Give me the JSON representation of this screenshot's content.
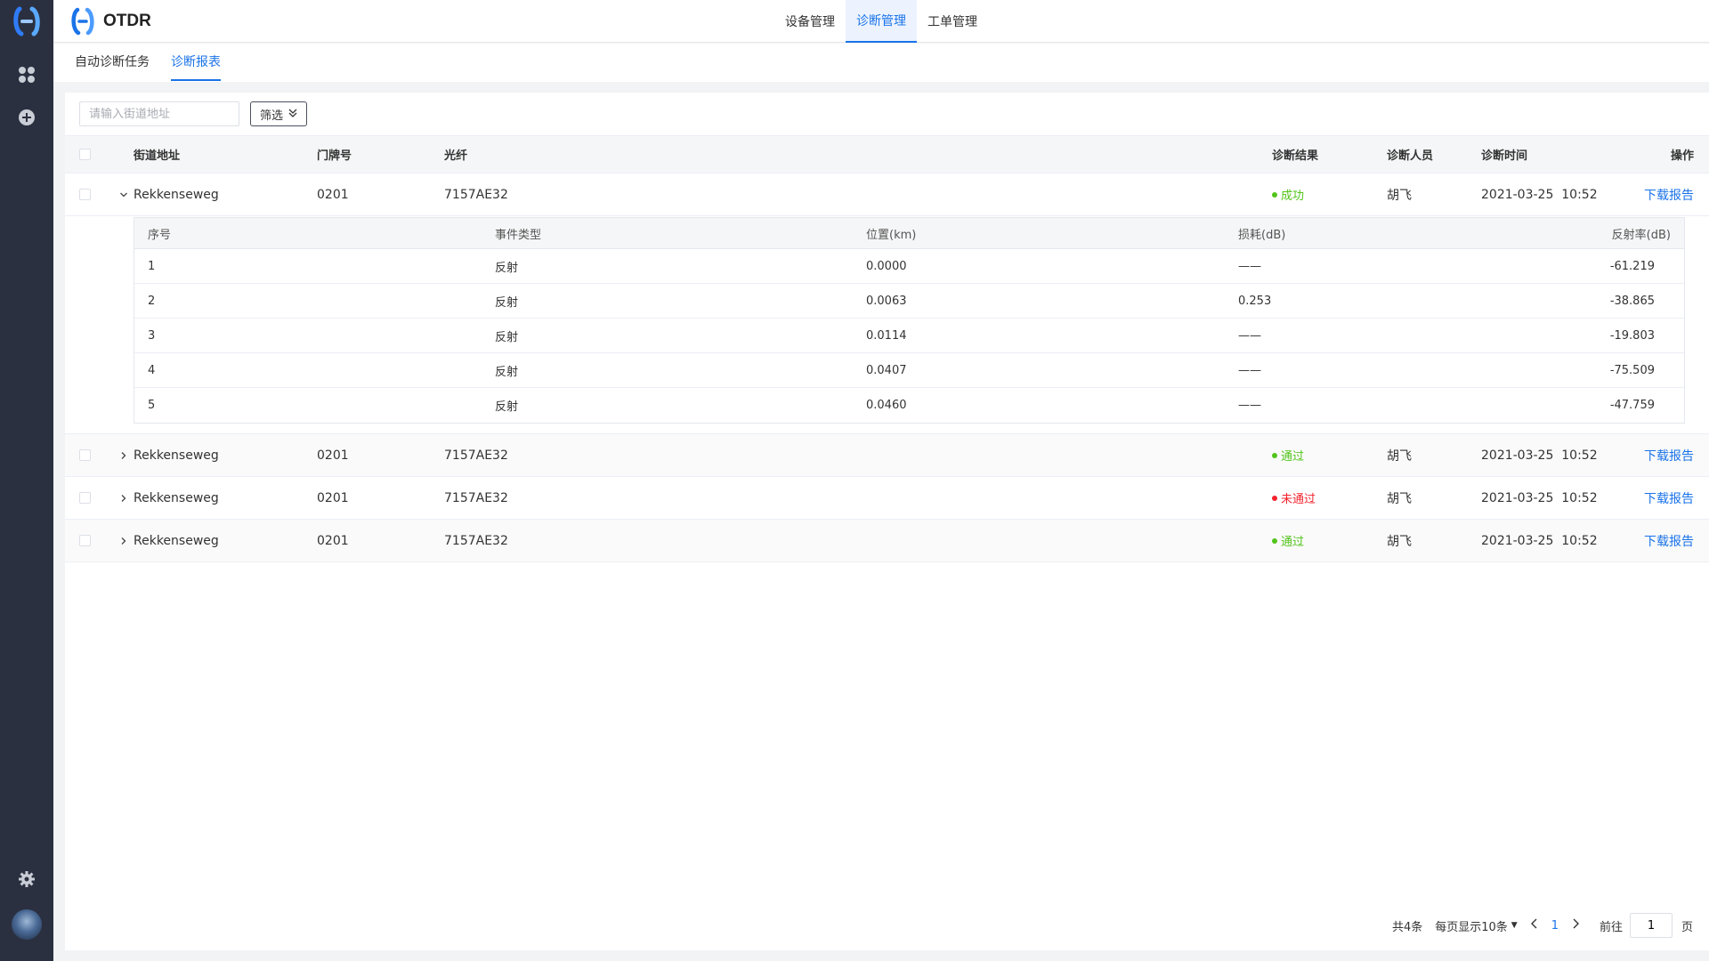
{
  "app": {
    "title": "OTDR",
    "brand_color": "#1a73e8",
    "rail_color": "#2b3040"
  },
  "rail": {
    "items": [
      {
        "icon": "apps-grid-icon"
      },
      {
        "icon": "add-circle-icon"
      },
      {
        "icon": "gear-icon"
      },
      {
        "icon": "avatar"
      }
    ]
  },
  "header": {
    "tabs": [
      {
        "label": "设备管理",
        "active": false
      },
      {
        "label": "诊断管理",
        "active": true
      },
      {
        "label": "工单管理",
        "active": false
      }
    ]
  },
  "subtabs": [
    {
      "label": "自动诊断任务",
      "active": false
    },
    {
      "label": "诊断报表",
      "active": true
    }
  ],
  "toolbar": {
    "search_placeholder": "请输入街道地址",
    "filter_label": "筛选"
  },
  "table": {
    "columns": {
      "street": "街道地址",
      "door": "门牌号",
      "fiber": "光纤",
      "result": "诊断结果",
      "person": "诊断人员",
      "time": "诊断时间",
      "action": "操作"
    },
    "rows": [
      {
        "street": "Rekkenseweg",
        "door": "0201",
        "fiber": "7157AE32",
        "result": "成功",
        "result_color": "#52c41a",
        "person": "胡飞",
        "time": "2021-03-25  10:52",
        "action": "下载报告",
        "expanded": true
      },
      {
        "street": "Rekkenseweg",
        "door": "0201",
        "fiber": "7157AE32",
        "result": "通过",
        "result_color": "#52c41a",
        "person": "胡飞",
        "time": "2021-03-25  10:52",
        "action": "下载报告",
        "expanded": false
      },
      {
        "street": "Rekkenseweg",
        "door": "0201",
        "fiber": "7157AE32",
        "result": "未通过",
        "result_color": "#f5222d",
        "person": "胡飞",
        "time": "2021-03-25  10:52",
        "action": "下载报告",
        "expanded": false
      },
      {
        "street": "Rekkenseweg",
        "door": "0201",
        "fiber": "7157AE32",
        "result": "通过",
        "result_color": "#52c41a",
        "person": "胡飞",
        "time": "2021-03-25  10:52",
        "action": "下载报告",
        "expanded": false
      }
    ],
    "detail": {
      "columns": {
        "index": "序号",
        "event": "事件类型",
        "position": "位置(km)",
        "loss": "损耗(dB)",
        "reflect": "反射率(dB)"
      },
      "rows": [
        {
          "index": "1",
          "event": "反射",
          "position": "0.0000",
          "loss": "——",
          "reflect": "-61.219"
        },
        {
          "index": "2",
          "event": "反射",
          "position": "0.0063",
          "loss": "0.253",
          "reflect": "-38.865"
        },
        {
          "index": "3",
          "event": "反射",
          "position": "0.0114",
          "loss": "——",
          "reflect": "-19.803"
        },
        {
          "index": "4",
          "event": "反射",
          "position": "0.0407",
          "loss": "——",
          "reflect": "-75.509"
        },
        {
          "index": "5",
          "event": "反射",
          "position": "0.0460",
          "loss": "——",
          "reflect": "-47.759"
        }
      ]
    }
  },
  "pagination": {
    "total": "共4条",
    "page_size": "每页显示10条",
    "current_page": "1",
    "goto_label": "前往",
    "goto_value": "1",
    "page_suffix": "页"
  }
}
